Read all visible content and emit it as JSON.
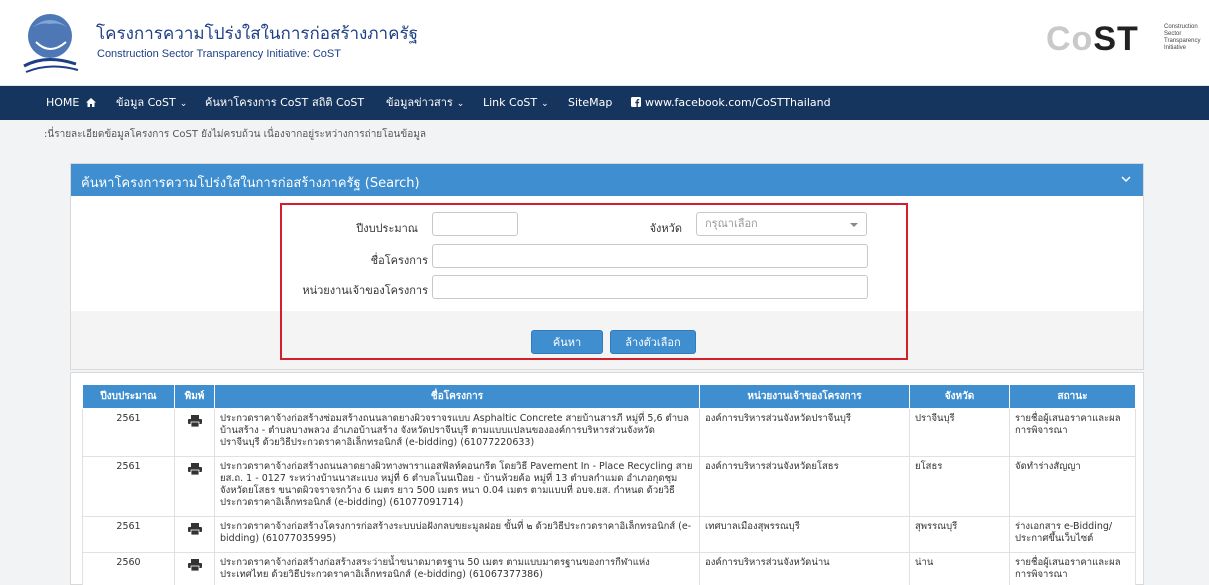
{
  "header": {
    "title_th": "โครงการความโปร่งใสในการก่อสร้างภาครัฐ",
    "title_en": "Construction Sector Transparency Initiative: CoST",
    "logo_right_word": "CoST",
    "logo_right_lines": [
      "Construction",
      "Sector",
      "Transparency",
      "Initiative"
    ]
  },
  "nav": {
    "items": [
      {
        "label": "HOME",
        "icon": "home-icon"
      },
      {
        "label": "ข้อมูล CoST",
        "dropdown": true
      },
      {
        "label": "ค้นหาโครงการ CoST"
      },
      {
        "label": "สถิติ CoST"
      },
      {
        "label": "ข้อมูลข่าวสาร",
        "dropdown": true
      },
      {
        "label": "Link CoST",
        "dropdown": true
      },
      {
        "label": "SiteMap"
      },
      {
        "label": "www.facebook.com/CoSTThailand",
        "icon": "facebook-icon"
      }
    ]
  },
  "notice": ":นี่รายละเอียดข้อมูลโครงการ CoST ยังไม่ครบถ้วน เนื่องจากอยู่ระหว่างการถ่ายโอนข้อมูล",
  "search": {
    "panel_title": "ค้นหาโครงการความโปร่งใสในการก่อสร้างภาครัฐ (Search)",
    "budget_year_label": "ปีงบประมาณ",
    "budget_year_value": "",
    "province_label": "จังหวัด",
    "province_placeholder": "กรุณาเลือก",
    "project_name_label": "ชื่อโครงการ",
    "project_name_value": "",
    "agency_label": "หน่วยงานเจ้าของโครงการ",
    "agency_value": "",
    "search_button": "ค้นหา",
    "clear_button": "ล้างตัวเลือก"
  },
  "colors": {
    "navbar": "#16355e",
    "accent": "#3e8ed0",
    "highlight_border": "#d2202a"
  },
  "results": {
    "columns": [
      "ปีงบประมาณ",
      "พิมพ์",
      "ชื่อโครงการ",
      "หน่วยงานเจ้าของโครงการ",
      "จังหวัด",
      "สถานะ"
    ],
    "rows": [
      {
        "year": "2561",
        "name": "ประกวดราคาจ้างก่อสร้างซ่อมสร้างถนนลาดยางผิวจราจรแบบ Asphaltic Concrete สายบ้านสารภี หมู่ที่ 5,6 ตำบลบ้านสร้าง - ตำบลบางพลวง อำเภอบ้านสร้าง จังหวัดปราจีนบุรี ตามแบบแปลนขององค์การบริหารส่วนจังหวัดปราจีนบุรี ด้วยวิธีประกวดราคาอิเล็กทรอนิกส์ (e-bidding) (61077220633)",
        "agency": "องค์การบริหารส่วนจังหวัดปราจีนบุรี",
        "province": "ปราจีนบุรี",
        "status": "รายชื่อผู้เสนอราคาและผลการพิจารณา"
      },
      {
        "year": "2561",
        "name": "ประกวดราคาจ้างก่อสร้างถนนลาดยางผิวทางพาราแอสฟัลท์คอนกรีต โดยวิธี Pavement In - Place Recycling สาย ยส.ถ. 1 - 0127 ระหว่างบ้านนาสะแบง หมู่ที่ 6 ตำบลโนนเปือย - บ้านห้วยค้อ หมู่ที่ 13 ตำบลกำแมด อำเภอกุดชุม จังหวัดยโสธร ขนาดผิวจราจรกว้าง 6 เมตร ยาว 500 เมตร หนา 0.04 เมตร ตามแบบที่ อบจ.ยส. กำหนด ด้วยวิธีประกวดราคาอิเล็กทรอนิกส์ (e-bidding) (61077091714)",
        "agency": "องค์การบริหารส่วนจังหวัดยโสธร",
        "province": "ยโสธร",
        "status": "จัดทำร่างสัญญา"
      },
      {
        "year": "2561",
        "name": "ประกวดราคาจ้างก่อสร้างโครงการก่อสร้างระบบบ่อฝังกลบขยะมูลฝอย ขั้นที่ ๒ ด้วยวิธีประกวดราคาอิเล็กทรอนิกส์ (e-bidding) (61077035995)",
        "agency": "เทศบาลเมืองสุพรรณบุรี",
        "province": "สุพรรณบุรี",
        "status": "ร่างเอกสาร e-Bidding/ประกาศขึ้นเว็บไซต์"
      },
      {
        "year": "2560",
        "name": "ประกวดราคาจ้างก่อสร้างก่อสร้างสระว่ายน้ำขนาดมาตรฐาน 50 เมตร ตามแบบมาตรฐานของการกีฬาแห่งประเทศไทย ด้วยวิธีประกวดราคาอิเล็กทรอนิกส์ (e-bidding) (61067377386)",
        "agency": "องค์การบริหารส่วนจังหวัดน่าน",
        "province": "น่าน",
        "status": "รายชื่อผู้เสนอราคาและผลการพิจารณา"
      }
    ]
  }
}
